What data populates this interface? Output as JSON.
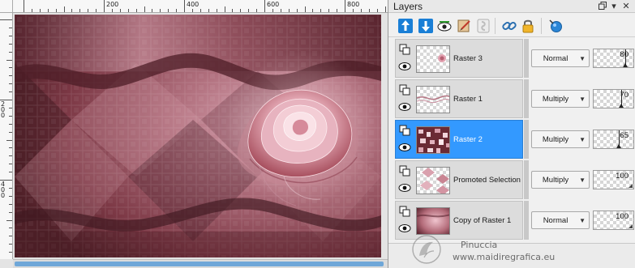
{
  "canvas": {
    "ruler_top_labels": [
      "200",
      "400",
      "600",
      "800"
    ],
    "ruler_left_labels": [
      "200",
      "400"
    ]
  },
  "layers_panel": {
    "title": "Layers",
    "controls": {
      "dock_icon": "dock-icon",
      "close_icon": "close-icon"
    },
    "toolbar_icons": [
      "new-raster-layer-icon",
      "new-vector-layer-icon",
      "layer-visibility-icon",
      "link-layers-icon",
      "mask-icon",
      "link-icon",
      "lock-icon",
      "layer-style-icon"
    ],
    "layers": [
      {
        "name": "Raster 3",
        "blend_mode": "Normal",
        "opacity": "80",
        "selected": false
      },
      {
        "name": "Raster 1",
        "blend_mode": "Multiply",
        "opacity": "70",
        "selected": false
      },
      {
        "name": "Raster 2",
        "blend_mode": "Multiply",
        "opacity": "65",
        "selected": true
      },
      {
        "name": "Promoted Selection",
        "blend_mode": "Multiply",
        "opacity": "100",
        "selected": false
      },
      {
        "name": "Copy of Raster 1",
        "blend_mode": "Normal",
        "opacity": "100",
        "selected": false
      }
    ],
    "colors": {
      "selection": "#3399ff",
      "rose": "#c4798a",
      "wine": "#6e2c38"
    }
  },
  "watermark": {
    "name": "Pinuccia",
    "url": "www.maidiregrafica.eu"
  }
}
